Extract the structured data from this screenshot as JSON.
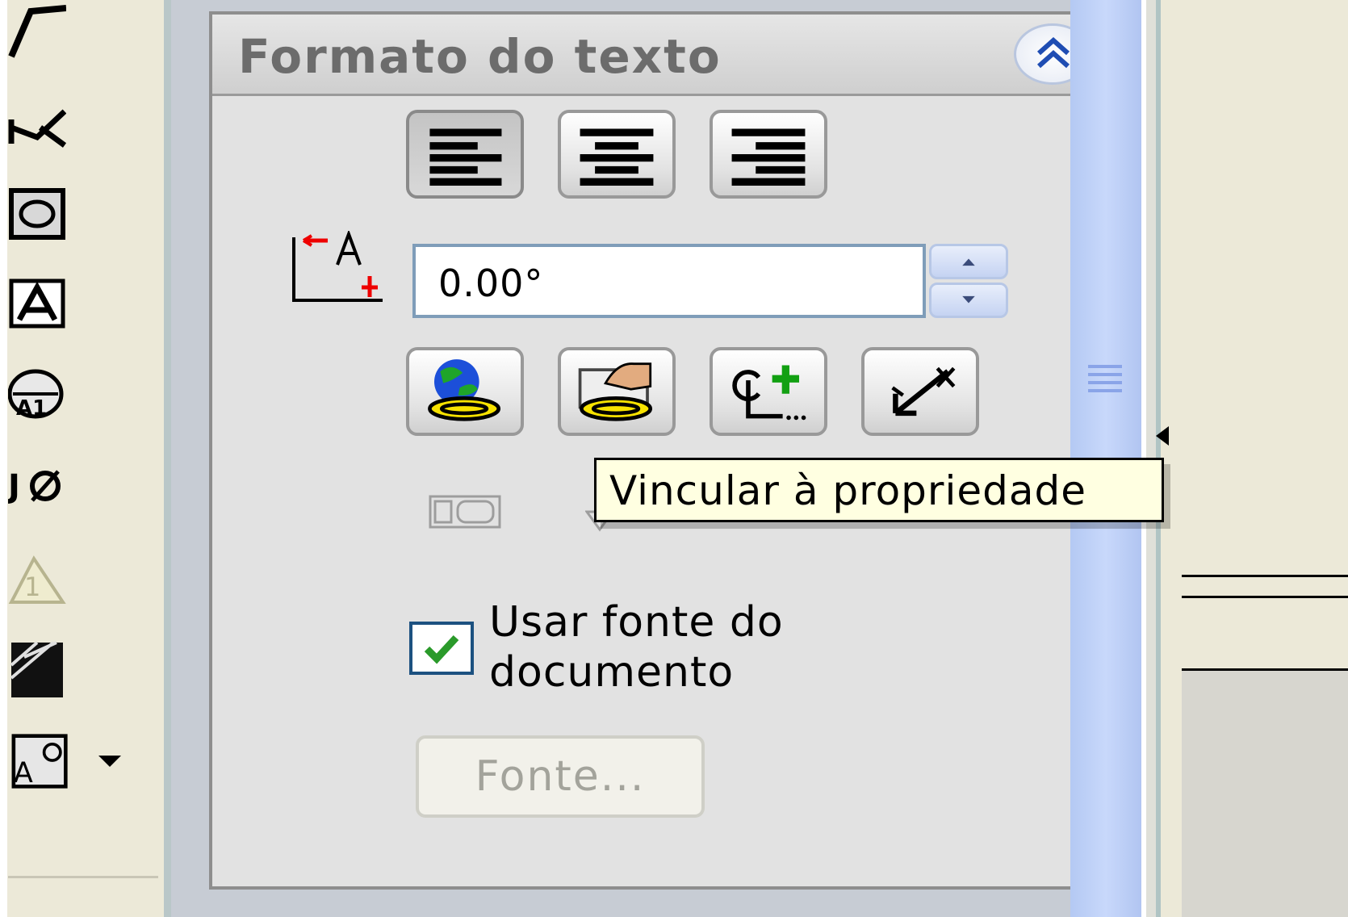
{
  "panel": {
    "title": "Formato do texto",
    "angle_value": "0.00°",
    "use_document_font_label": "Usar fonte do documento",
    "use_document_font_checked": true,
    "font_button_label": "Fonte..."
  },
  "tooltip": {
    "text": "Vincular à propriedade"
  },
  "colors": {
    "panel_bg": "#e2e2e2",
    "tooltip_bg": "#ffffe1",
    "scrollbar": "#c0d3f8",
    "checkbox_border": "#1c5180",
    "check_mark": "#2a9a2a"
  },
  "icons": {
    "align_left": "align-left-icon",
    "align_center": "align-center-icon",
    "align_right": "align-right-icon",
    "angle": "text-angle-icon",
    "link_globe": "link-to-property-globe-icon",
    "link_hand": "link-to-property-hand-icon",
    "add_symbol": "add-symbol-icon",
    "leader_arrow": "leader-arrow-icon"
  }
}
